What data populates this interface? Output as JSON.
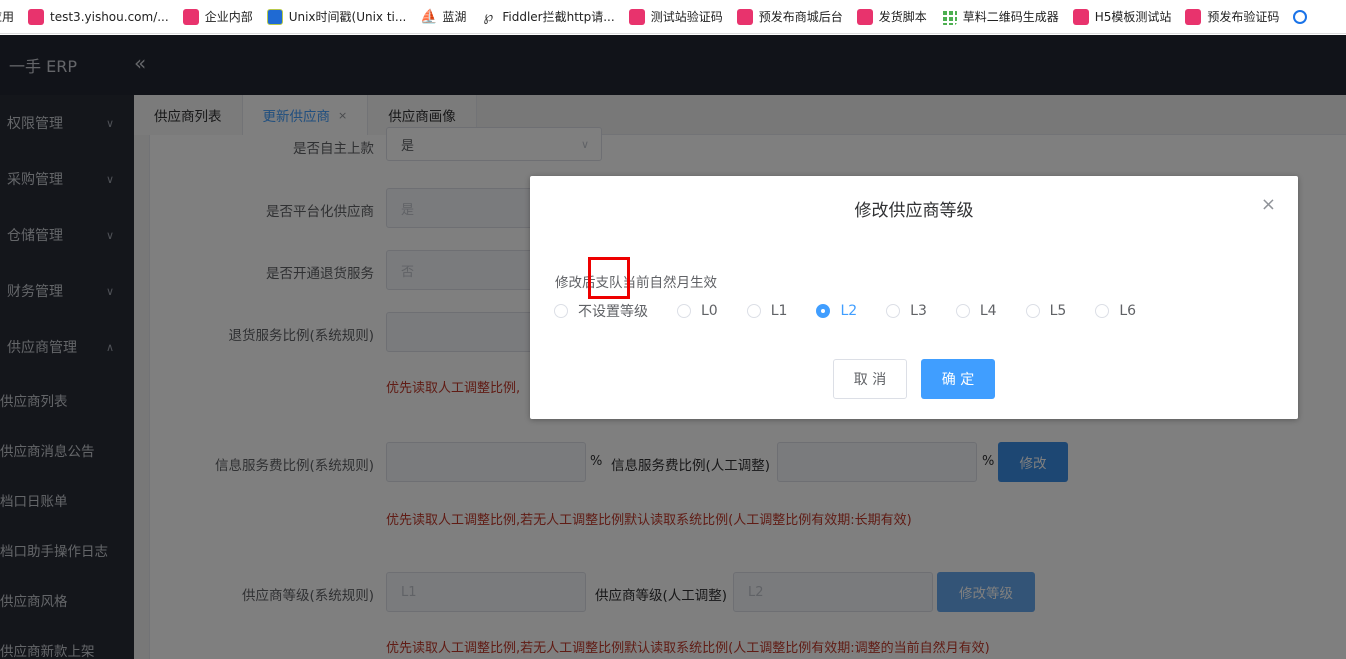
{
  "bookmarks": [
    {
      "label": "应用",
      "icon": "apps-icon"
    },
    {
      "label": "test3.yishou.com/...",
      "icon": "pink-icon"
    },
    {
      "label": "企业内部",
      "icon": "pink-icon"
    },
    {
      "label": "Unix时间戳(Unix ti...",
      "icon": "unix-icon"
    },
    {
      "label": "蓝湖",
      "icon": "lanhu-icon"
    },
    {
      "label": "Fiddler拦截http请...",
      "icon": "fiddler-icon"
    },
    {
      "label": "测试站验证码",
      "icon": "pink-icon"
    },
    {
      "label": "预发布商城后台",
      "icon": "pink-icon"
    },
    {
      "label": "发货脚本",
      "icon": "pink-icon"
    },
    {
      "label": "草料二维码生成器",
      "icon": "qr-icon"
    },
    {
      "label": "H5模板测试站",
      "icon": "pink-icon"
    },
    {
      "label": "预发布验证码",
      "icon": "pink-icon"
    }
  ],
  "header": {
    "logo": "一手 ERP",
    "collapse_icon": "«"
  },
  "sidebar": {
    "menus": [
      {
        "label": "权限管理",
        "arrow": "∨"
      },
      {
        "label": "采购管理",
        "arrow": "∨"
      },
      {
        "label": "仓储管理",
        "arrow": "∨"
      },
      {
        "label": "财务管理",
        "arrow": "∨"
      },
      {
        "label": "供应商管理",
        "arrow": "∧"
      }
    ],
    "subitems": [
      "供应商列表",
      "供应商消息公告",
      "档口日账单",
      "档口助手操作日志",
      "供应商风格",
      "供应商新款上架"
    ]
  },
  "tabs": [
    {
      "label": "供应商列表",
      "active": false
    },
    {
      "label": "更新供应商",
      "active": true,
      "close": "×"
    },
    {
      "label": "供应商画像",
      "active": false
    }
  ],
  "form": {
    "self_listing_label": "是否自主上款",
    "self_listing_value": "是",
    "platform_label": "是否平台化供应商",
    "platform_value": "是",
    "return_service_label": "是否开通退货服务",
    "return_service_value": "否",
    "return_ratio_label": "退货服务比例(系统规则)",
    "return_note": "优先读取人工调整比例,",
    "info_fee_label": "信息服务费比例(系统规则)",
    "pct1": "%",
    "info_fee_manual_label": "信息服务费比例(人工调整)",
    "pct2": "%",
    "modify_btn": "修改",
    "info_note": "优先读取人工调整比例,若无人工调整比例默认读取系统比例(人工调整比例有效期:长期有效)",
    "level_label": "供应商等级(系统规则)",
    "level_value": "L1",
    "level_manual_label": "供应商等级(人工调整)",
    "level_manual_value": "L2",
    "modify_level_btn": "修改等级",
    "level_note": "优先读取人工调整比例,若无人工调整比例默认读取系统比例(人工调整比例有效期:调整的当前自然月有效)"
  },
  "dialog": {
    "title": "修改供应商等级",
    "close": "×",
    "tip": "修改后支队当前自然月生效",
    "options": [
      "不设置等级",
      "L0",
      "L1",
      "L2",
      "L3",
      "L4",
      "L5",
      "L6"
    ],
    "selected": "L2",
    "cancel": "取 消",
    "ok": "确 定"
  }
}
